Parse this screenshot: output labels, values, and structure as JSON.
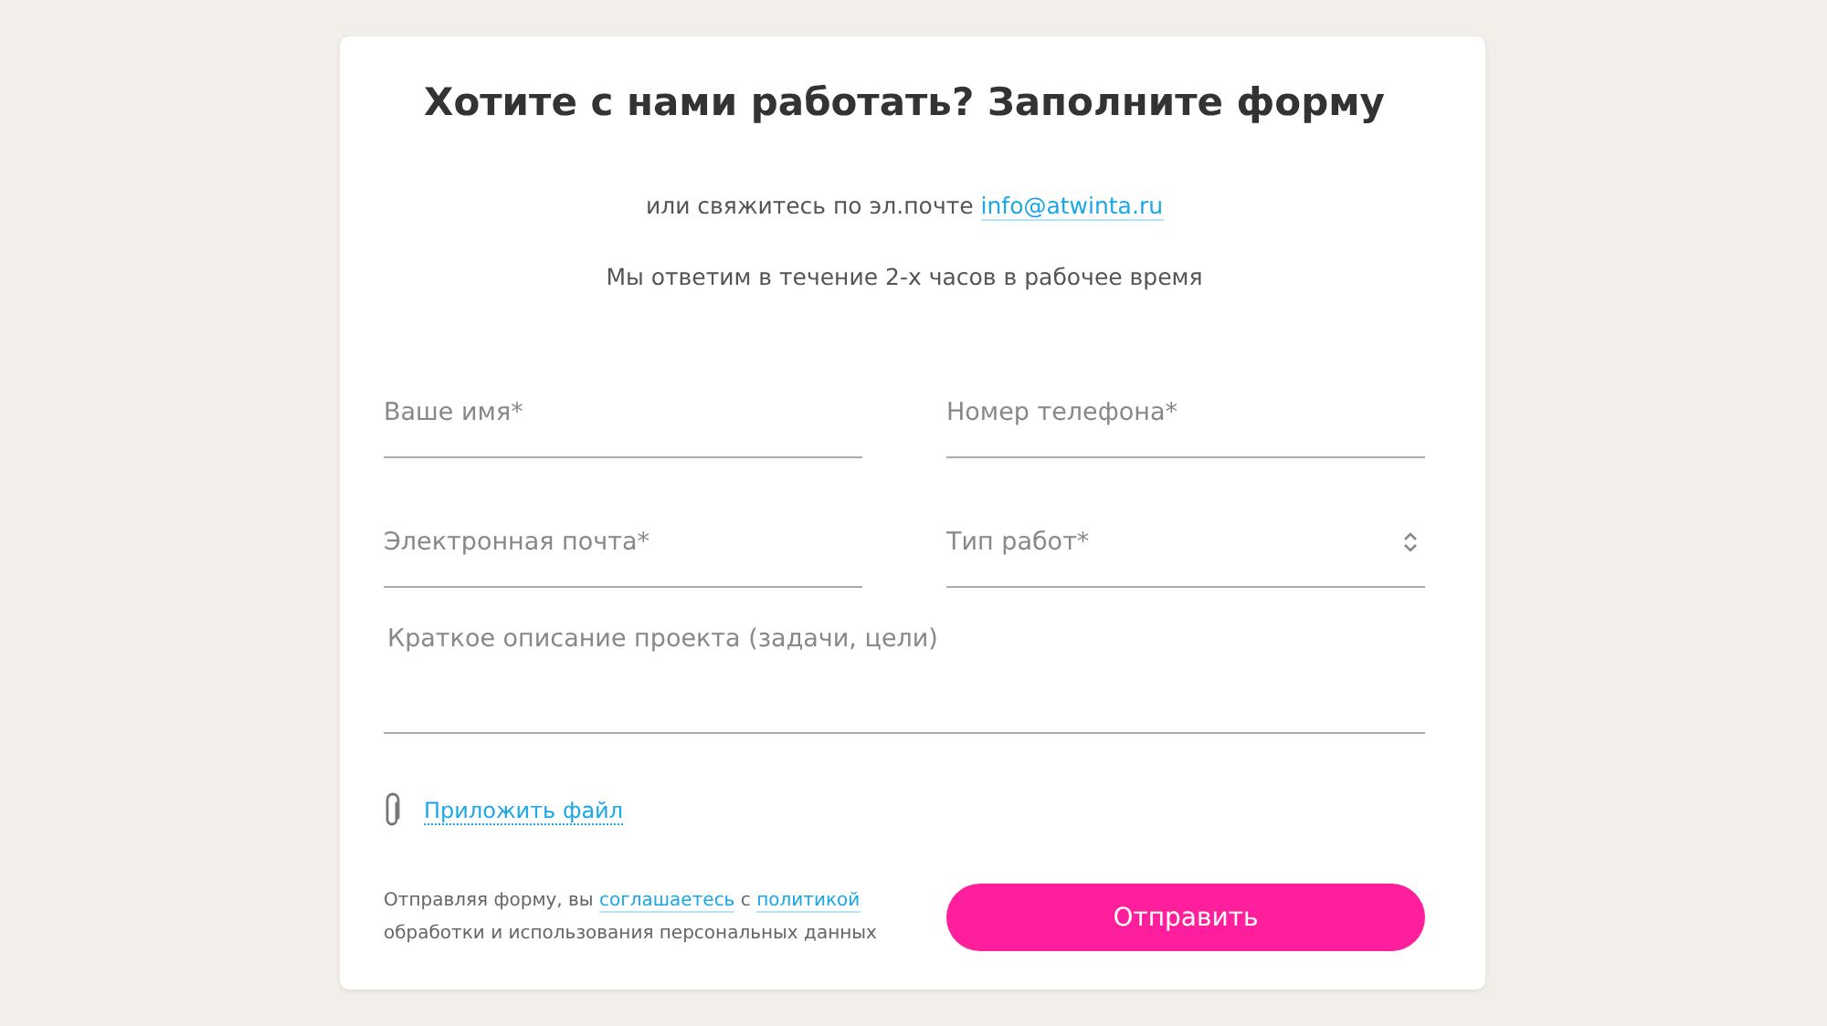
{
  "title": "Хотите с нами работать? Заполните форму",
  "contact": {
    "text": "или свяжитесь по эл.почте",
    "email": "info@atwinta.ru"
  },
  "note": "Мы ответим в течение 2-х часов в рабочее время",
  "fields": [
    {
      "kind": "input",
      "placeholder": "Ваше имя*"
    },
    {
      "kind": "input",
      "placeholder": "Номер телефона*"
    },
    {
      "kind": "input",
      "placeholder": "Электронная почта*"
    },
    {
      "kind": "select",
      "placeholder": "Тип работ*"
    },
    {
      "kind": "textarea",
      "placeholder": "Краткое описание проекта (задачи, цели)"
    }
  ],
  "attach": "Приложить файл",
  "consent": [
    {
      "kind": "text",
      "text": "Отправляя форму, вы "
    },
    {
      "kind": "link",
      "text": "соглашаетесь"
    },
    {
      "kind": "text",
      "text": " с "
    },
    {
      "kind": "link",
      "text": "политикой"
    },
    {
      "kind": "text",
      "text": " обработки и использования персональных данных"
    }
  ],
  "submit": "Отправить"
}
